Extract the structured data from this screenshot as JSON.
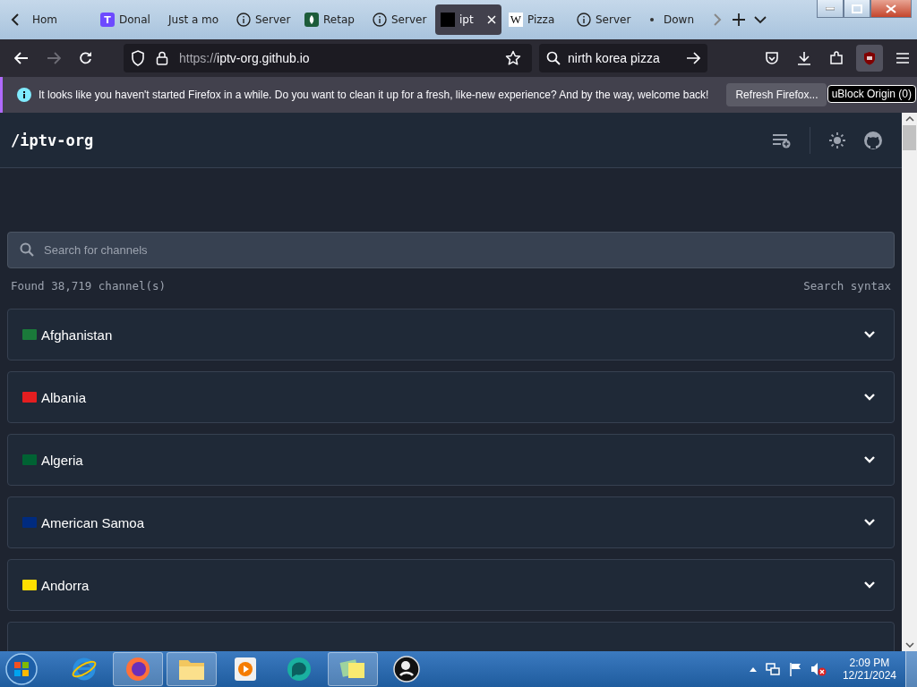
{
  "tabs": [
    {
      "label": "Hom",
      "kind": "plain",
      "selected": false
    },
    {
      "label": "Donal",
      "kind": "t",
      "selected": false
    },
    {
      "label": "Just a mo",
      "kind": "plain",
      "selected": false
    },
    {
      "label": "Server",
      "kind": "info",
      "selected": false
    },
    {
      "label": "Retap",
      "kind": "leaf",
      "selected": false
    },
    {
      "label": "Server",
      "kind": "info",
      "selected": false
    },
    {
      "label": "ipt",
      "kind": "square",
      "selected": true
    },
    {
      "label": "Pizza",
      "kind": "w",
      "selected": false
    },
    {
      "label": "Server",
      "kind": "info",
      "selected": false
    },
    {
      "label": "Down",
      "kind": "dot",
      "selected": false
    }
  ],
  "tab_icon_letters": {
    "t": "T",
    "w": "W"
  },
  "address_bar": {
    "url_prefix": "https://",
    "url_host": "iptv-org.github.io"
  },
  "search_bar": {
    "value": "nirth korea pizza"
  },
  "notification": {
    "message": "It looks like you haven't started Firefox in a while. Do you want to clean it up for a fresh, like-new experience? And by the way, welcome back!",
    "button": "Refresh Firefox...",
    "extension_tooltip": "uBlock Origin (0)"
  },
  "site": {
    "logo": "/iptv-org",
    "search": {
      "placeholder": "Search for channels"
    },
    "found": "Found 38,719 channel(s)",
    "syntax_link": "Search syntax",
    "countries": [
      {
        "name": "Afghanistan",
        "color": "#1a7a3a",
        "expanded": false
      },
      {
        "name": "Albania",
        "color": "#e41e20",
        "expanded": false
      },
      {
        "name": "Algeria",
        "color": "#006233",
        "expanded": false
      },
      {
        "name": "American Samoa",
        "color": "#002b7f",
        "expanded": false
      },
      {
        "name": "Andorra",
        "color": "#fedf00",
        "expanded": false
      }
    ]
  },
  "taskbar": {
    "time": "2:09 PM",
    "date": "12/21/2024"
  }
}
